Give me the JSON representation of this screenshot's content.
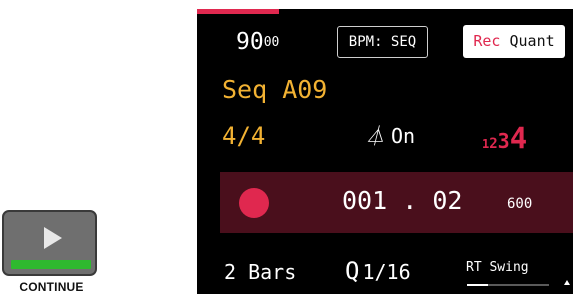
{
  "continue_widget": {
    "label": "CONTINUE",
    "progress": 1.0,
    "icon": "play-icon"
  },
  "device": {
    "top_accent_color": "#e0284f",
    "tempo": {
      "main": "90",
      "decimal": "00"
    },
    "bpm_button": "BPM: SEQ",
    "rec_quant_button": {
      "rec": "Rec",
      "quant": "Quant"
    },
    "sequence_name": "Seq A09",
    "time_signature": "4/4",
    "metronome": {
      "icon": "metronome-icon",
      "state": "On"
    },
    "count_in": [
      "1",
      "2",
      "3",
      "4"
    ],
    "transport": {
      "record_indicator": "record-dot",
      "position_bars": "001",
      "separator": ".",
      "position_beats": "02",
      "ticks": "600"
    },
    "bars": "2 Bars",
    "quantize": {
      "icon": "quantize-icon",
      "value": "1/16"
    },
    "swing": {
      "label": "RT Swing",
      "level": 0.25
    },
    "colors": {
      "accent_red": "#e0284f",
      "accent_yellow": "#f2b233",
      "transport_bg": "#4a0f1c"
    }
  }
}
